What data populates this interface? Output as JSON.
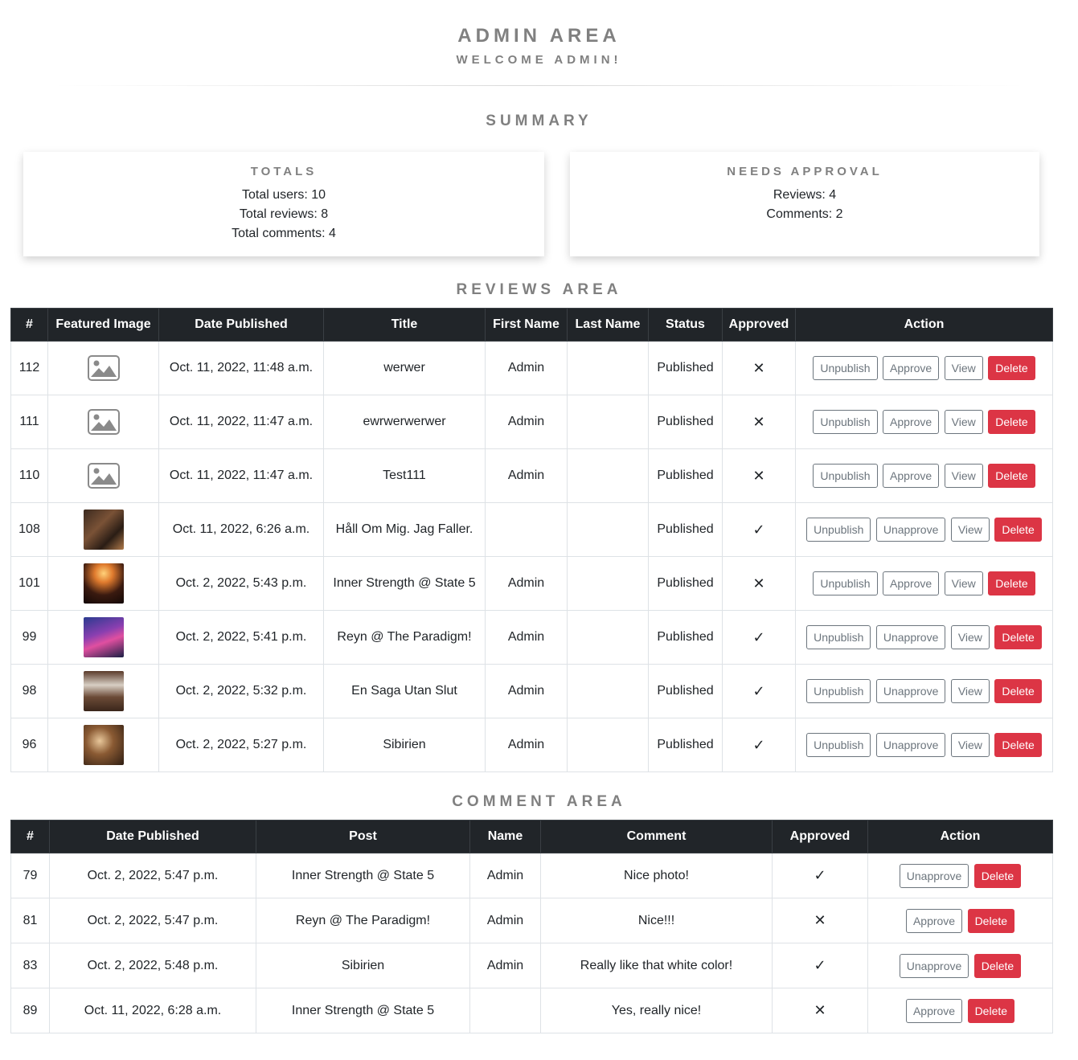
{
  "header": {
    "title": "ADMIN AREA",
    "subtitle": "WELCOME ADMIN!"
  },
  "summary": {
    "title": "SUMMARY",
    "totals": {
      "title": "TOTALS",
      "lines": [
        "Total users: 10",
        "Total reviews: 8",
        "Total comments: 4"
      ]
    },
    "needs_approval": {
      "title": "NEEDS APPROVAL",
      "lines": [
        "Reviews: 4",
        "Comments: 2"
      ]
    }
  },
  "reviews": {
    "title": "REVIEWS AREA",
    "headers": [
      "#",
      "Featured Image",
      "Date Published",
      "Title",
      "First Name",
      "Last Name",
      "Status",
      "Approved",
      "Action"
    ],
    "rows": [
      {
        "id": "112",
        "image": "placeholder",
        "date": "Oct. 11, 2022, 11:48 a.m.",
        "title": "werwer",
        "first_name": "Admin",
        "last_name": "",
        "status": "Published",
        "approved": "✕",
        "actions": [
          "Unpublish",
          "Approve",
          "View",
          "Delete"
        ]
      },
      {
        "id": "111",
        "image": "placeholder",
        "date": "Oct. 11, 2022, 11:47 a.m.",
        "title": "ewrwerwerwer",
        "first_name": "Admin",
        "last_name": "",
        "status": "Published",
        "approved": "✕",
        "actions": [
          "Unpublish",
          "Approve",
          "View",
          "Delete"
        ]
      },
      {
        "id": "110",
        "image": "placeholder",
        "date": "Oct. 11, 2022, 11:47 a.m.",
        "title": "Test111",
        "first_name": "Admin",
        "last_name": "",
        "status": "Published",
        "approved": "✕",
        "actions": [
          "Unpublish",
          "Approve",
          "View",
          "Delete"
        ]
      },
      {
        "id": "108",
        "image": "photo-records",
        "date": "Oct. 11, 2022, 6:26 a.m.",
        "title": "Håll Om Mig. Jag Faller.",
        "first_name": "",
        "last_name": "",
        "status": "Published",
        "approved": "✓",
        "actions": [
          "Unpublish",
          "Unapprove",
          "View",
          "Delete"
        ]
      },
      {
        "id": "101",
        "image": "photo-concert",
        "date": "Oct. 2, 2022, 5:43 p.m.",
        "title": "Inner Strength @ State 5",
        "first_name": "Admin",
        "last_name": "",
        "status": "Published",
        "approved": "✕",
        "actions": [
          "Unpublish",
          "Approve",
          "View",
          "Delete"
        ]
      },
      {
        "id": "99",
        "image": "photo-dj",
        "date": "Oct. 2, 2022, 5:41 p.m.",
        "title": "Reyn @ The Paradigm!",
        "first_name": "Admin",
        "last_name": "",
        "status": "Published",
        "approved": "✓",
        "actions": [
          "Unpublish",
          "Unapprove",
          "View",
          "Delete"
        ]
      },
      {
        "id": "98",
        "image": "photo-vinyl",
        "date": "Oct. 2, 2022, 5:32 p.m.",
        "title": "En Saga Utan Slut",
        "first_name": "Admin",
        "last_name": "",
        "status": "Published",
        "approved": "✓",
        "actions": [
          "Unpublish",
          "Unapprove",
          "View",
          "Delete"
        ]
      },
      {
        "id": "96",
        "image": "photo-table",
        "date": "Oct. 2, 2022, 5:27 p.m.",
        "title": "Sibirien",
        "first_name": "Admin",
        "last_name": "",
        "status": "Published",
        "approved": "✓",
        "actions": [
          "Unpublish",
          "Unapprove",
          "View",
          "Delete"
        ]
      }
    ]
  },
  "comments": {
    "title": "COMMENT AREA",
    "headers": [
      "#",
      "Date Published",
      "Post",
      "Name",
      "Comment",
      "Approved",
      "Action"
    ],
    "rows": [
      {
        "id": "79",
        "date": "Oct. 2, 2022, 5:47 p.m.",
        "post": "Inner Strength @ State 5",
        "name": "Admin",
        "comment": "Nice photo!",
        "approved": "✓",
        "actions": [
          "Unapprove",
          "Delete"
        ]
      },
      {
        "id": "81",
        "date": "Oct. 2, 2022, 5:47 p.m.",
        "post": "Reyn @ The Paradigm!",
        "name": "Admin",
        "comment": "Nice!!!",
        "approved": "✕",
        "actions": [
          "Approve",
          "Delete"
        ]
      },
      {
        "id": "83",
        "date": "Oct. 2, 2022, 5:48 p.m.",
        "post": "Sibirien",
        "name": "Admin",
        "comment": "Really like that white color!",
        "approved": "✓",
        "actions": [
          "Unapprove",
          "Delete"
        ]
      },
      {
        "id": "89",
        "date": "Oct. 11, 2022, 6:28 a.m.",
        "post": "Inner Strength @ State 5",
        "name": "",
        "comment": "Yes, really nice!",
        "approved": "✕",
        "actions": [
          "Approve",
          "Delete"
        ]
      }
    ]
  },
  "colors": {
    "heading_gray": "#808080",
    "table_header_bg": "#212529",
    "delete_red": "#dc3545",
    "outline_gray": "#6c757d"
  }
}
